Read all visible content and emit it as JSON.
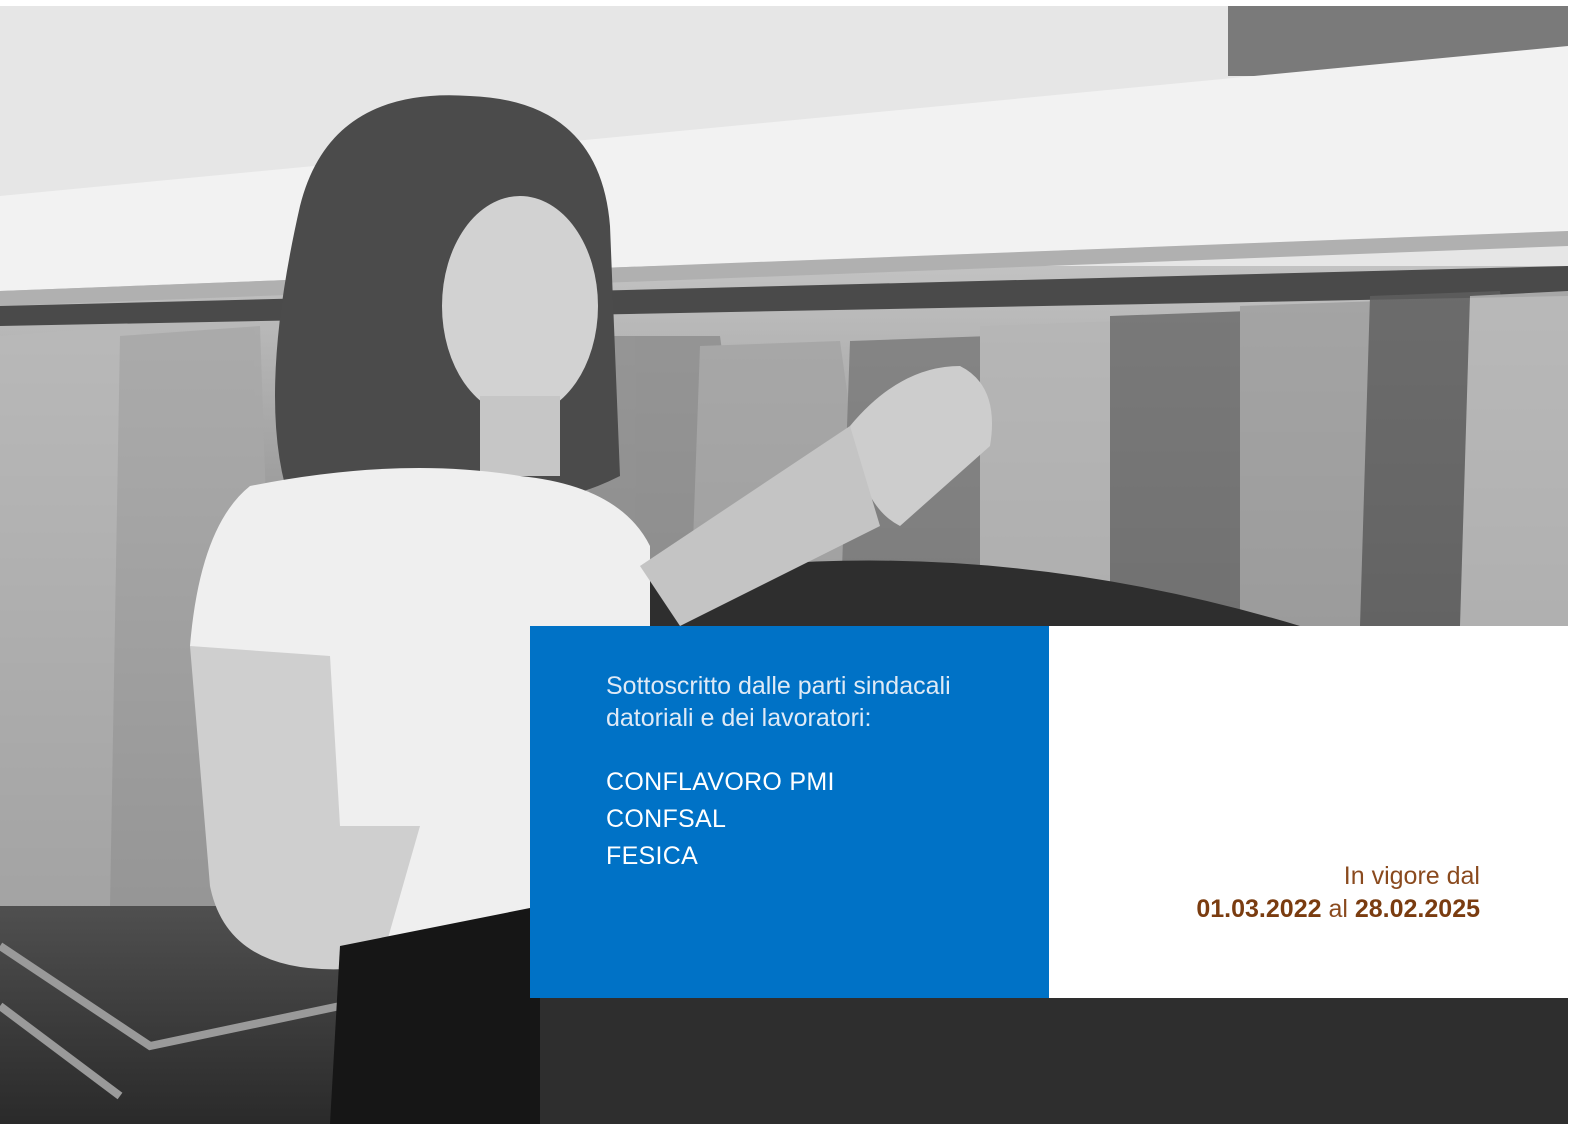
{
  "cover": {
    "photo_description": "Woman holding garment in dry-cleaning shop",
    "intro_text": "Sottoscritto dalle parti sindacali datoriali e dei lavoratori:",
    "signatories": [
      "CONFLAVORO PMI",
      "CONFSAL",
      "FESICA"
    ],
    "validity": {
      "label": "In vigore dal",
      "from": "01.03.2022",
      "separator": "al",
      "to": "28.02.2025"
    }
  },
  "colors": {
    "accent_blue": "#0072c6",
    "accent_brown": "#7a3c10",
    "panel_white": "#ffffff"
  }
}
